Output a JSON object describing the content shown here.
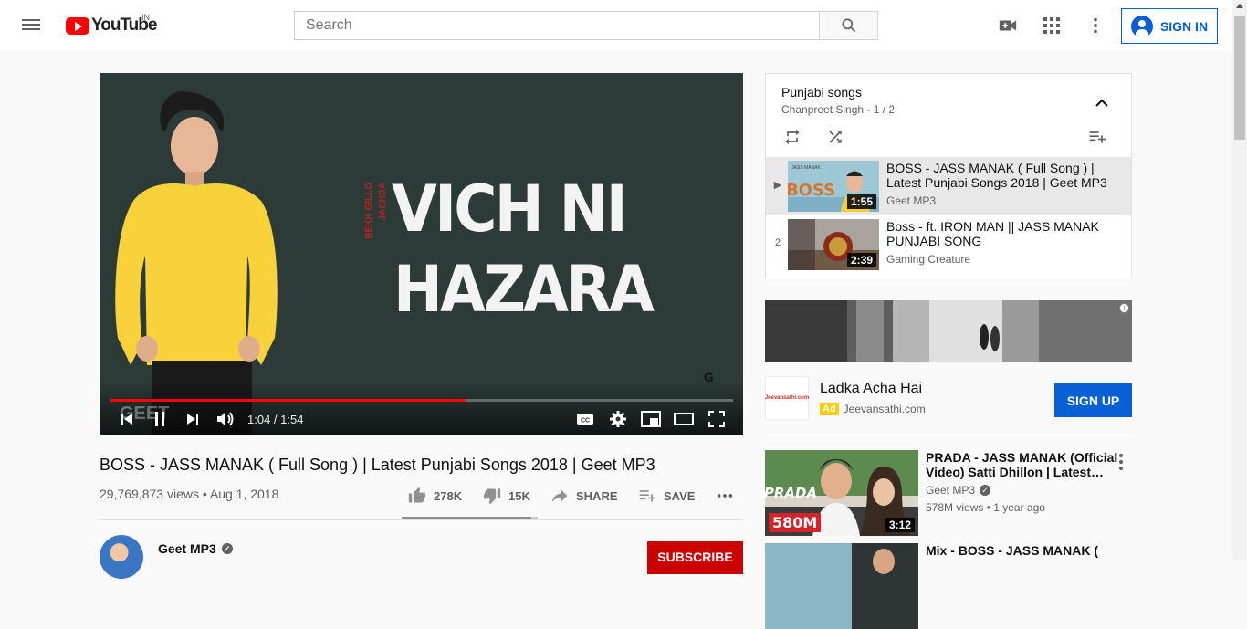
{
  "header": {
    "logo_text": "YouTube",
    "country_code": "IN",
    "search_placeholder": "Search",
    "sign_in_label": "SIGN IN"
  },
  "player": {
    "overlay_line1": "VICH NI",
    "overlay_line2": "HAZARA",
    "overlay_credit1": "BEKH GILLO",
    "overlay_credit2": "JACHDA",
    "overlay_mark": "G",
    "watermark": "GEET",
    "time_display": "1:04 / 1:54",
    "progress_fraction": 0.57
  },
  "video": {
    "title": "BOSS - JASS MANAK ( Full Song ) | Latest Punjabi Songs 2018 | Geet MP3",
    "views": "29,769,873 views • Aug 1, 2018",
    "likes": "278K",
    "dislikes": "15K",
    "share_label": "SHARE",
    "save_label": "SAVE",
    "like_ratio": 0.95
  },
  "channel": {
    "name": "Geet MP3",
    "subscribe_label": "SUBSCRIBE"
  },
  "playlist": {
    "title": "Punjabi songs",
    "subtitle": "Chanpreet Singh - 1 / 2",
    "items": [
      {
        "index": "▶",
        "title": "BOSS - JASS MANAK ( Full Song ) | Latest Punjabi Songs 2018 | Geet MP3",
        "channel": "Geet MP3",
        "duration": "1:55",
        "thumb_text": "BOSS",
        "thumb_artist": "JASS MANAK"
      },
      {
        "index": "2",
        "title": "Boss - ft. IRON MAN || JASS MANAK PUNJABI SONG",
        "channel": "Gaming Creature",
        "duration": "2:39"
      }
    ]
  },
  "ad": {
    "title": "Ladka Acha Hai",
    "badge": "Ad",
    "domain": "Jeevansathi.com",
    "logo_text": "Jeevansathi.com",
    "cta_label": "SIGN UP",
    "info_glyph": "i"
  },
  "recommendations": [
    {
      "title": "PRADA - JASS MANAK (Official Video) Satti Dhillon | Latest…",
      "channel": "Geet MP3",
      "views": "578M views • 1 year ago",
      "duration": "3:12",
      "thumb_text": "PRADA",
      "thumb_badge": "580M"
    },
    {
      "title": "Mix - BOSS - JASS MANAK (",
      "channel": "",
      "views": ""
    }
  ],
  "colors": {
    "brand_red": "#ff0000",
    "link_blue": "#065fd4",
    "subscribe_red": "#cc0000",
    "progress_red": "#ff0000"
  }
}
